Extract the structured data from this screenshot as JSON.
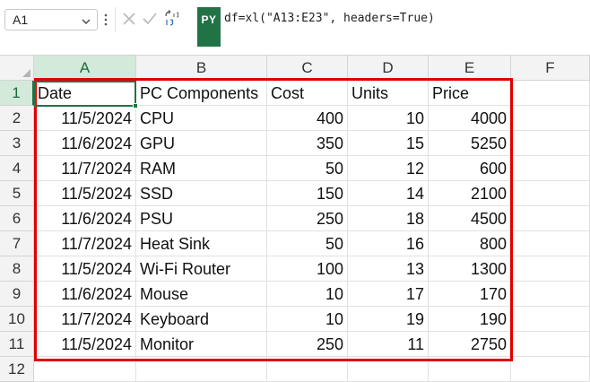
{
  "formula_bar": {
    "name_box": "A1",
    "python_badge": "PY",
    "formula": "df=xl(\"A13:E23\", headers=True)"
  },
  "icons": {
    "name_box_dropdown": "chevron-down-icon",
    "more": "vertical-dots-icon",
    "cancel": "close-icon",
    "enter": "checkmark-icon",
    "python_output": "python-output-type-icon"
  },
  "columns": [
    "A",
    "B",
    "C",
    "D",
    "E",
    "F"
  ],
  "rows": [
    "1",
    "2",
    "3",
    "4",
    "5",
    "6",
    "7",
    "8",
    "9",
    "10",
    "11",
    "12"
  ],
  "table": {
    "headers": [
      "Date",
      "PC Components",
      "Cost",
      "Units",
      "Price"
    ],
    "rows": [
      [
        "11/5/2024",
        "CPU",
        "400",
        "10",
        "4000"
      ],
      [
        "11/6/2024",
        "GPU",
        "350",
        "15",
        "5250"
      ],
      [
        "11/7/2024",
        "RAM",
        "50",
        "12",
        "600"
      ],
      [
        "11/5/2024",
        "SSD",
        "150",
        "14",
        "2100"
      ],
      [
        "11/6/2024",
        "PSU",
        "250",
        "18",
        "4500"
      ],
      [
        "11/7/2024",
        "Heat Sink",
        "50",
        "16",
        "800"
      ],
      [
        "11/5/2024",
        "Wi-Fi Router",
        "100",
        "13",
        "1300"
      ],
      [
        "11/6/2024",
        "Mouse",
        "10",
        "17",
        "170"
      ],
      [
        "11/7/2024",
        "Keyboard",
        "10",
        "19",
        "190"
      ],
      [
        "11/5/2024",
        "Monitor",
        "250",
        "11",
        "2750"
      ]
    ]
  },
  "colors": {
    "excel_green": "#217346",
    "highlight_border": "#e00000",
    "header_bg": "#f3f3f3",
    "active_header_bg": "#d3e9da"
  }
}
